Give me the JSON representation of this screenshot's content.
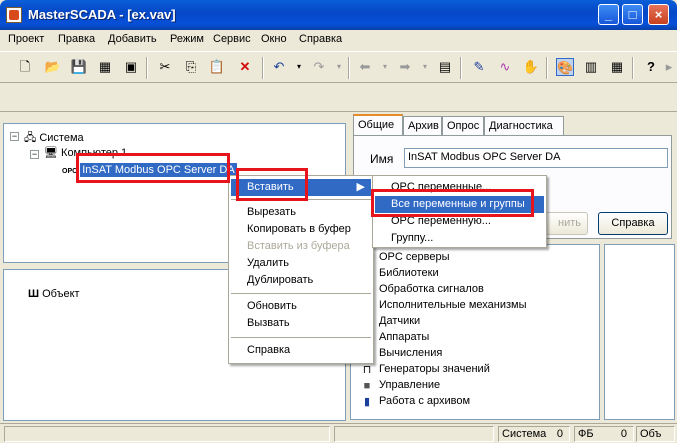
{
  "window": {
    "title": "MasterSCADA - [ex.vav]"
  },
  "menu": [
    "Проект",
    "Правка",
    "Добавить",
    "Режим",
    "Сервис",
    "Окно",
    "Справка"
  ],
  "tree": {
    "root": "Система",
    "computer": "Компьютер 1",
    "server": "InSAT Modbus OPC Server DA",
    "opc_badge": "OPC"
  },
  "object_tree": {
    "root": "Объект"
  },
  "tabs": [
    "Общие",
    "Архив",
    "Опрос",
    "Диагностика"
  ],
  "props": {
    "name_label": "Имя",
    "name_value": "InSAT Modbus OPC Server DA",
    "apply_fragment": "нить",
    "help_button": "Справка"
  },
  "library": [
    "OPC серверы",
    "Библиотеки",
    "Обработка сигналов",
    "Исполнительные механизмы",
    "Датчики",
    "Аппараты",
    "Вычисления",
    "Генераторы значений",
    "Управление",
    "Работа с архивом"
  ],
  "context_menu": {
    "insert": "Вставить",
    "cut": "Вырезать",
    "copy": "Копировать в буфер",
    "paste": "Вставить из буфера",
    "delete": "Удалить",
    "duplicate": "Дублировать",
    "refresh": "Обновить",
    "call": "Вызвать",
    "help": "Справка"
  },
  "submenu": {
    "opc_vars": "OPC переменные...",
    "all_vars": "Все переменные и группы",
    "opc_var_manual": "OPC переменную...",
    "group": "Группу..."
  },
  "status": {
    "system_label": "Система",
    "system_count": "0",
    "fb_label": "ФБ",
    "fb_count": "0",
    "obj_label": "Объ"
  },
  "colors": {
    "highlight": "#316ac5",
    "annotation_red": "#e8141c",
    "titlebar": "#0548c7"
  }
}
